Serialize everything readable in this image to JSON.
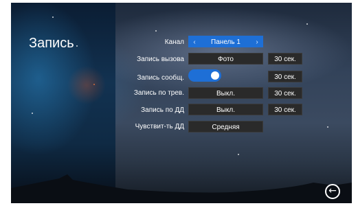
{
  "title": "Запись",
  "rows": [
    {
      "label": "Канал",
      "value": "Панель 1"
    },
    {
      "label": "Запись вызова",
      "value": "Фото",
      "duration": "30 сек."
    },
    {
      "label": "Запись сообщ.",
      "toggle": "on",
      "duration": "30 сек."
    },
    {
      "label": "Запись по трев.",
      "value": "Выкл.",
      "duration": "30 сек."
    },
    {
      "label": "Запись по ДД",
      "value": "Выкл.",
      "duration": "30 сек."
    },
    {
      "label": "Чувствит-ть ДД",
      "value": "Средняя"
    }
  ],
  "icons": {
    "prev": "chevron-left-icon",
    "next": "chevron-right-icon",
    "back": "back-arrow-icon"
  },
  "colors": {
    "accent": "#1e6fd6",
    "field_bg": "#2a2a2a"
  }
}
